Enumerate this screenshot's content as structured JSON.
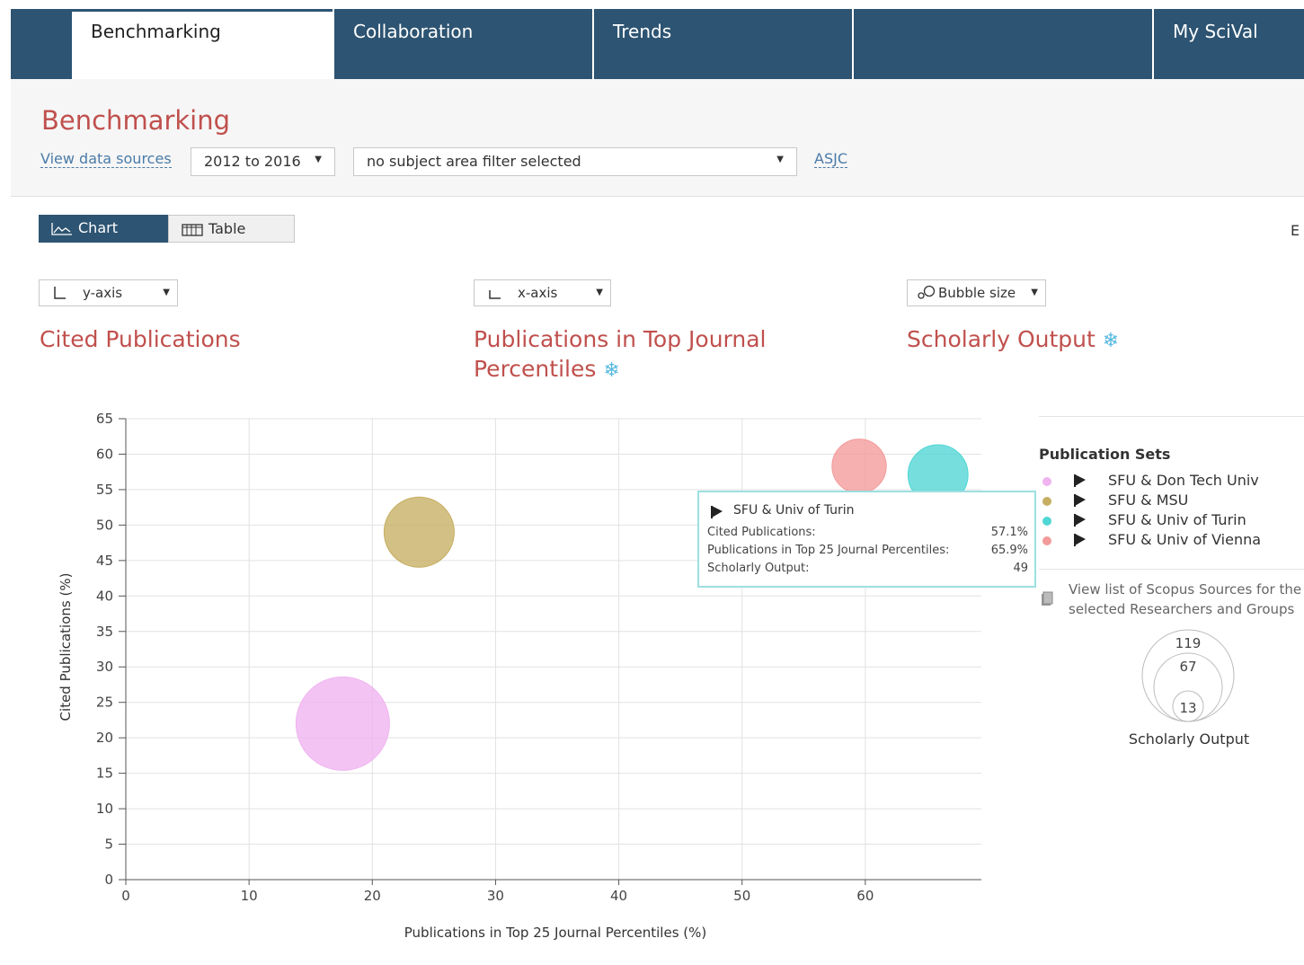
{
  "nav": {
    "tabs": [
      {
        "label": "Benchmarking",
        "active": true
      },
      {
        "label": "Collaboration",
        "active": false
      },
      {
        "label": "Trends",
        "active": false
      },
      {
        "label": "",
        "active": false
      },
      {
        "label": "My SciVal",
        "active": false
      }
    ]
  },
  "header": {
    "title": "Benchmarking",
    "view_sources": "View data sources",
    "year_range": "2012 to 2016",
    "subject_filter": "no subject area filter selected",
    "asjc": "ASJC"
  },
  "view_toggle": {
    "chart": "Chart",
    "table": "Table",
    "selected": "Chart"
  },
  "export_cut": "E",
  "axes_selectors": {
    "y_select": "y-axis",
    "x_select": "x-axis",
    "bubble_select": "Bubble size",
    "y_metric": "Cited Publications",
    "x_metric_line1": "Publications in Top Journal",
    "x_metric_line2": "Percentiles",
    "bubble_metric": "Scholarly Output"
  },
  "chart_data": {
    "type": "scatter",
    "xlabel": "Publications in Top 25 Journal Percentiles (%)",
    "ylabel": "Cited Publications (%)",
    "xlim": [
      0,
      70
    ],
    "ylim": [
      0,
      65
    ],
    "x_ticks": [
      0,
      10,
      20,
      30,
      40,
      50,
      60
    ],
    "y_ticks": [
      0,
      5,
      10,
      15,
      20,
      25,
      30,
      35,
      40,
      45,
      50,
      55,
      60,
      65
    ],
    "grid": true,
    "series": [
      {
        "name": "SFU & Don Tech Univ",
        "color": "#f0b3f0",
        "x": 17.6,
        "y": 22.0,
        "size": 119
      },
      {
        "name": "SFU & MSU",
        "color": "#c6ae62",
        "x": 23.8,
        "y": 49.0,
        "size": 67
      },
      {
        "name": "SFU & Univ of Turin",
        "color": "#4fd6d5",
        "x": 65.9,
        "y": 57.1,
        "size": 49
      },
      {
        "name": "SFU & Univ of Vienna",
        "color": "#f39a9a",
        "x": 59.5,
        "y": 58.3,
        "size": 40
      }
    ]
  },
  "tooltip": {
    "title": "SFU & Univ of Turin",
    "rows": [
      {
        "label": "Cited Publications:",
        "value": "57.1%"
      },
      {
        "label": "Publications in Top 25 Journal Percentiles:",
        "value": "65.9%"
      },
      {
        "label": "Scholarly Output:",
        "value": "49"
      }
    ]
  },
  "legend": {
    "title": "Publication Sets",
    "items": [
      {
        "label": "SFU & Don Tech Univ",
        "color": "#f0b3f0"
      },
      {
        "label": "SFU & MSU",
        "color": "#c6ae62"
      },
      {
        "label": "SFU & Univ of Turin",
        "color": "#4fd6d5"
      },
      {
        "label": "SFU & Univ of Vienna",
        "color": "#f39a9a"
      }
    ],
    "scopus_line1": "View list of Scopus Sources for the",
    "scopus_line2": "selected Researchers and Groups",
    "size_key": {
      "values": [
        "119",
        "67",
        "13"
      ],
      "caption": "Scholarly Output"
    }
  },
  "colors": {
    "nav_bg": "#2d5472",
    "accent_red": "#c0504d",
    "link": "#4a7ba8",
    "freeze": "#56b8e0"
  }
}
